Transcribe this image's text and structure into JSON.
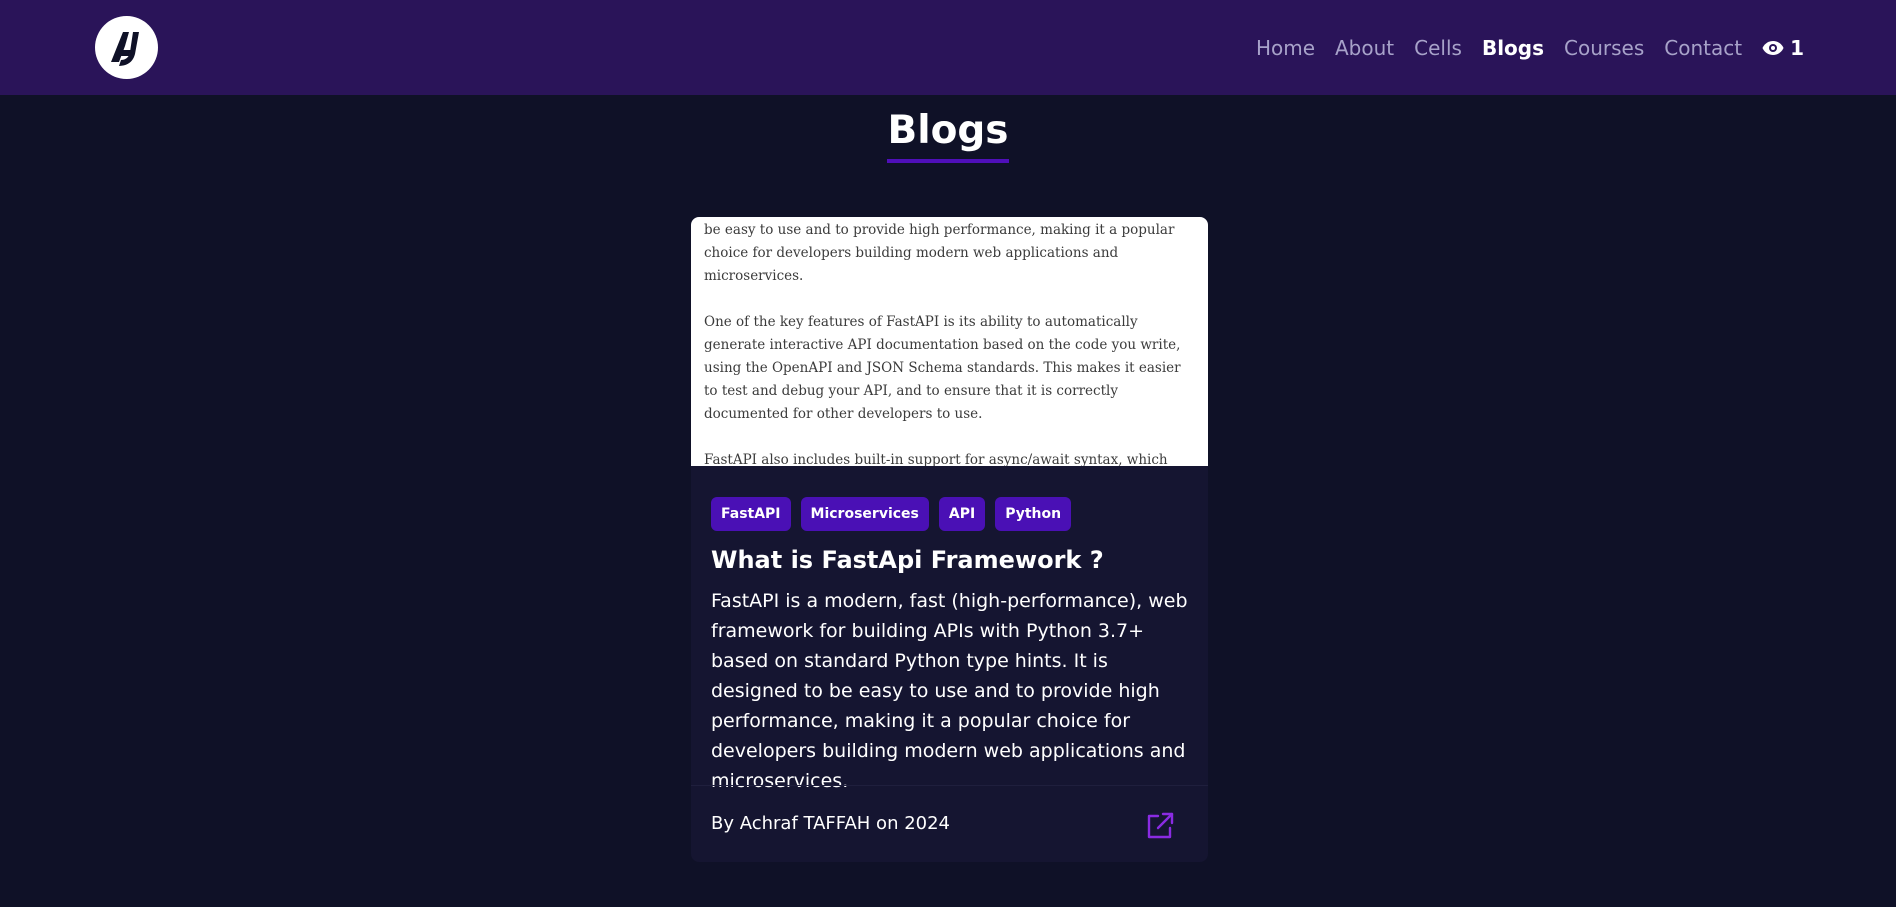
{
  "nav": {
    "logo_alt": "AJ",
    "links": [
      {
        "label": "Home",
        "active": false
      },
      {
        "label": "About",
        "active": false
      },
      {
        "label": "Cells",
        "active": false
      },
      {
        "label": "Blogs",
        "active": true
      },
      {
        "label": "Courses",
        "active": false
      },
      {
        "label": "Contact",
        "active": false
      }
    ],
    "views_icon": "eye-icon",
    "views_count": "1"
  },
  "page": {
    "title": "Blogs"
  },
  "blog_card": {
    "preview_paragraphs": [
      "be easy to use and to provide high performance, making it a popular choice for developers building modern web applications and microservices.",
      "One of the key features of FastAPI is its ability to automatically generate interactive API documentation based on the code you write, using the OpenAPI and JSON Schema standards. This makes it easier to test and debug your API, and to ensure that it is correctly documented for other developers to use.",
      "FastAPI also includes built-in support for async/await syntax, which allows for efficient handling of multiple concurrent requests. This can result in"
    ],
    "tags": [
      "FastAPI",
      "Microservices",
      "API",
      "Python"
    ],
    "title": "What is FastApi Framework ?",
    "description": "FastAPI is a modern, fast (high-performance), web framework for building APIs with Python 3.7+ based on standard Python type hints. It is designed to be easy to use and to provide high performance, making it a popular choice for developers building modern web applications and microservices.",
    "byline": "By Achraf TAFFAH on 2024",
    "open_icon": "external-link-icon"
  },
  "colors": {
    "nav_bg": "#2a1459",
    "page_bg": "#0f1127",
    "accent": "#4a10b5",
    "card_bg": "#151531",
    "link_icon": "#8a2be2"
  }
}
